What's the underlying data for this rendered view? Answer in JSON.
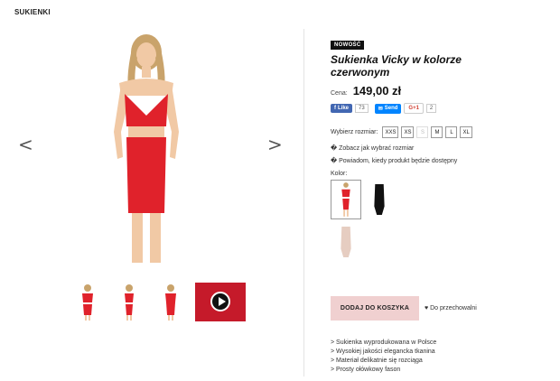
{
  "header": {
    "title": "SUKIENKI"
  },
  "gallery": {
    "prev_arrow": "<",
    "next_arrow": ">"
  },
  "product": {
    "badge": "NOWOŚĆ",
    "name": "Sukienka Vicky w kolorze czerwonym",
    "price_label": "Cena:",
    "price": "149,00 zł"
  },
  "social": {
    "fb_label": "Like",
    "fb_count": "73",
    "send_label": "Send",
    "gplus_label": "G+1",
    "gplus_count": "2"
  },
  "sizes": {
    "label": "Wybierz rozmiar:",
    "options": [
      {
        "label": "XXS",
        "available": true
      },
      {
        "label": "XS",
        "available": true
      },
      {
        "label": "S",
        "available": false
      },
      {
        "label": "M",
        "available": true
      },
      {
        "label": "L",
        "available": true
      },
      {
        "label": "XL",
        "available": true
      }
    ]
  },
  "links": {
    "size_guide": "� Zobacz jak wybrać rozmiar",
    "notify": "� Powiadom, kiedy produkt będzie dostępny"
  },
  "colors": {
    "label": "Kolor:",
    "swatches": [
      "red",
      "black",
      "beige"
    ],
    "hex": {
      "red": "#e0222b",
      "black": "#111111",
      "beige": "#e6cdc1"
    }
  },
  "actions": {
    "add_to_cart": "DODAJ DO KOSZYKA",
    "wishlist": "♥ Do przechowalni"
  },
  "features": [
    "> Sukienka wyprodukowana w Polsce",
    "> Wysokiej jakości elegancka tkanina",
    "> Materiał delikatnie się rozciąga",
    "> Prosty ołówkowy fason"
  ],
  "theme": {
    "accent": "#e0222b",
    "cart_bg": "#f0d0d0"
  }
}
